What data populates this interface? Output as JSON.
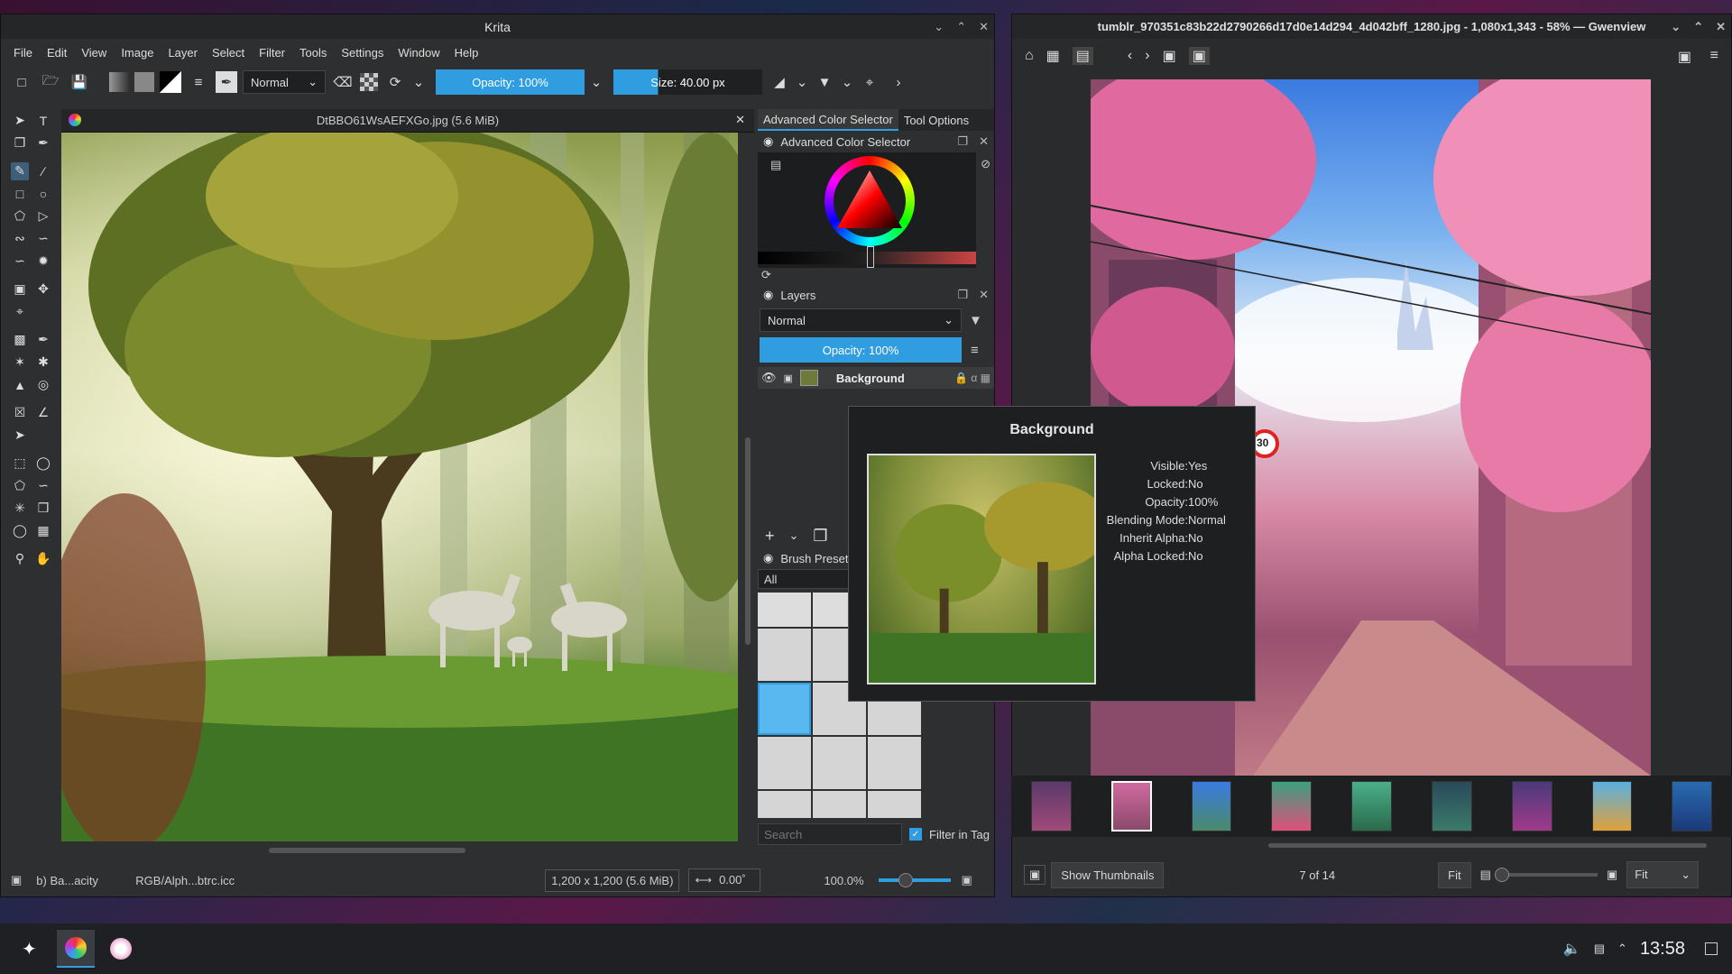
{
  "krita": {
    "title": "Krita",
    "menu": [
      "File",
      "Edit",
      "View",
      "Image",
      "Layer",
      "Select",
      "Filter",
      "Tools",
      "Settings",
      "Window",
      "Help"
    ],
    "blend_mode": "Normal",
    "opacity": "Opacity: 100%",
    "size": "Size: 40.00 px",
    "doc_tab": "DtBBO61WsAEFXGo.jpg (5.6 MiB)",
    "dock_tabs": [
      "Advanced Color Selector",
      "Tool Options"
    ],
    "color_selector_title": "Advanced Color Selector",
    "layers_title": "Layers",
    "layers_blend": "Normal",
    "layers_opacity": "Opacity:  100%",
    "layer_name": "Background",
    "brush_title": "Brush Preset",
    "brush_filter": "All",
    "search_placeholder": "Search",
    "filter_in_tag": "Filter in Tag",
    "status": {
      "tool": "b) Ba...acity",
      "color_profile": "RGB/Alph...btrc.icc",
      "image_size": "1,200 x 1,200 (5.6 MiB)",
      "rotation": "0.00˚",
      "zoom": "100.0%"
    },
    "colors": {
      "accent": "#2f9de0",
      "bg": "#2e2f30"
    }
  },
  "tooltip": {
    "title": "Background",
    "props": [
      {
        "k": "Visible:",
        "v": "Yes"
      },
      {
        "k": "Locked:",
        "v": "No"
      },
      {
        "k": "Opacity:",
        "v": "100%"
      },
      {
        "k": "Blending Mode:",
        "v": "Normal"
      },
      {
        "k": "Inherit Alpha:",
        "v": "No"
      },
      {
        "k": "Alpha Locked:",
        "v": "No"
      }
    ]
  },
  "gwenview": {
    "title": "tumblr_970351c83b22d2790266d17d0e14d294_4d042bff_1280.jpg - 1,080x1,343 - 58% — Gwenview",
    "show_thumbnails": "Show Thumbnails",
    "position": "7 of 14",
    "fit_button": "Fit",
    "zoom_mode": "Fit",
    "sign_text": "30"
  },
  "taskbar": {
    "time": "13:58"
  }
}
